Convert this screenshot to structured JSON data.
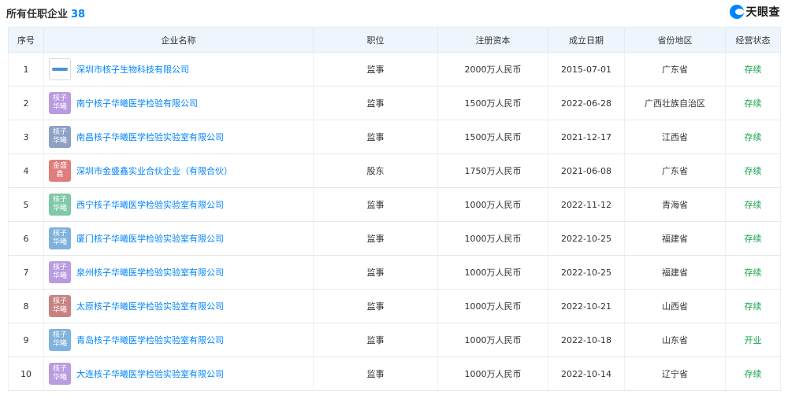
{
  "header": {
    "title": "所有任职企业",
    "count": "38",
    "brand": "天眼查",
    "brand_icon": "tianyancha-logo-icon"
  },
  "columns": [
    "序号",
    "企业名称",
    "职位",
    "注册资本",
    "成立日期",
    "省份地区",
    "经营状态"
  ],
  "rows": [
    {
      "index": "1",
      "logo_type": "image",
      "logo_color": "#4a90d9",
      "logo_text": [],
      "name": "深圳市核子生物科技有限公司",
      "position": "监事",
      "capital": "2000万人民币",
      "date": "2015-07-01",
      "region": "广东省",
      "status": "存续"
    },
    {
      "index": "2",
      "logo_type": "text",
      "logo_color": "#b89be0",
      "logo_text": [
        "核子",
        "华曦"
      ],
      "name": "南宁核子华曦医学检验有限公司",
      "position": "监事",
      "capital": "1500万人民币",
      "date": "2022-06-28",
      "region": "广西壮族自治区",
      "status": "存续"
    },
    {
      "index": "3",
      "logo_type": "text",
      "logo_color": "#8ea0c4",
      "logo_text": [
        "核子",
        "华曦"
      ],
      "name": "南昌核子华曦医学检验实验室有限公司",
      "position": "监事",
      "capital": "1500万人民币",
      "date": "2021-12-17",
      "region": "江西省",
      "status": "存续"
    },
    {
      "index": "4",
      "logo_type": "text",
      "logo_color": "#e17d7d",
      "logo_text": [
        "金盛",
        "鑫"
      ],
      "name": "深圳市金盛鑫实业合伙企业（有限合伙）",
      "position": "股东",
      "capital": "1750万人民币",
      "date": "2021-06-08",
      "region": "广东省",
      "status": "存续"
    },
    {
      "index": "5",
      "logo_type": "text",
      "logo_color": "#7fc8a9",
      "logo_text": [
        "核子",
        "华曦"
      ],
      "name": "西宁核子华曦医学检验实验室有限公司",
      "position": "监事",
      "capital": "1000万人民币",
      "date": "2022-11-12",
      "region": "青海省",
      "status": "存续"
    },
    {
      "index": "6",
      "logo_type": "text",
      "logo_color": "#7fb2dc",
      "logo_text": [
        "核子",
        "华曦"
      ],
      "name": "厦门核子华曦医学检验实验室有限公司",
      "position": "监事",
      "capital": "1000万人民币",
      "date": "2022-10-25",
      "region": "福建省",
      "status": "存续"
    },
    {
      "index": "7",
      "logo_type": "text",
      "logo_color": "#b89be0",
      "logo_text": [
        "核子",
        "华曦"
      ],
      "name": "泉州核子华曦医学检验实验室有限公司",
      "position": "监事",
      "capital": "1000万人民币",
      "date": "2022-10-25",
      "region": "福建省",
      "status": "存续"
    },
    {
      "index": "8",
      "logo_type": "text",
      "logo_color": "#c98282",
      "logo_text": [
        "核子",
        "华曦"
      ],
      "name": "太原核子华曦医学检验实验室有限公司",
      "position": "监事",
      "capital": "1000万人民币",
      "date": "2022-10-21",
      "region": "山西省",
      "status": "存续"
    },
    {
      "index": "9",
      "logo_type": "text",
      "logo_color": "#7fb2dc",
      "logo_text": [
        "核子",
        "华曦"
      ],
      "name": "青岛核子华曦医学检验实验室有限公司",
      "position": "监事",
      "capital": "1000万人民币",
      "date": "2022-10-18",
      "region": "山东省",
      "status": "开业"
    },
    {
      "index": "10",
      "logo_type": "text",
      "logo_color": "#b89be0",
      "logo_text": [
        "核子",
        "华曦"
      ],
      "name": "大连核子华曦医学检验实验室有限公司",
      "position": "监事",
      "capital": "1000万人民币",
      "date": "2022-10-14",
      "region": "辽宁省",
      "status": "存续"
    }
  ],
  "colors": {
    "link": "#0084ff",
    "status": "#16a34a",
    "header_bg": "#eef5fc"
  }
}
